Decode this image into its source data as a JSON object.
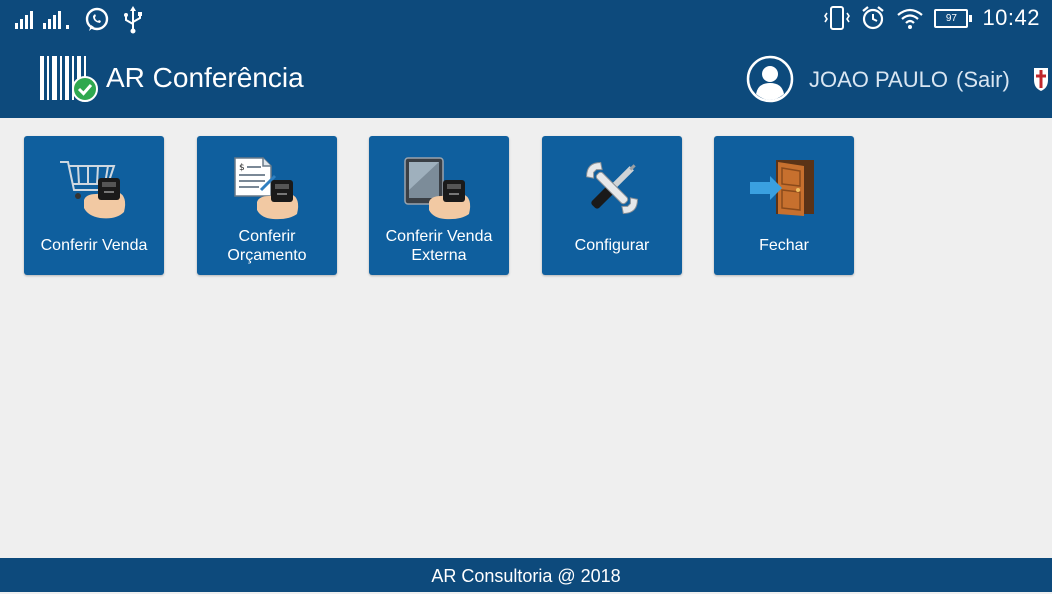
{
  "status_bar": {
    "time": "10:42",
    "battery_level": "97",
    "icons": [
      "signal-icon",
      "whatsapp-icon",
      "usb-icon",
      "vibrate-icon",
      "alarm-icon",
      "wifi-icon",
      "battery-icon"
    ]
  },
  "app_bar": {
    "title": "AR Conferência",
    "user_name": "JOAO PAULO",
    "logout_label": "(Sair)"
  },
  "tiles": [
    {
      "label": "Conferir Venda",
      "icon": "shopping-cart-scanner-icon"
    },
    {
      "label": "Conferir Orçamento",
      "icon": "document-scanner-icon"
    },
    {
      "label": "Conferir Venda Externa",
      "icon": "tablet-scanner-icon"
    },
    {
      "label": "Configurar",
      "icon": "wrench-screwdriver-icon"
    },
    {
      "label": "Fechar",
      "icon": "exit-door-icon"
    }
  ],
  "footer": {
    "text": "AR Consultoria @ 2018"
  },
  "colors": {
    "primary": "#0d4a7c",
    "tile": "#0f5f9e",
    "background": "#efefef"
  }
}
